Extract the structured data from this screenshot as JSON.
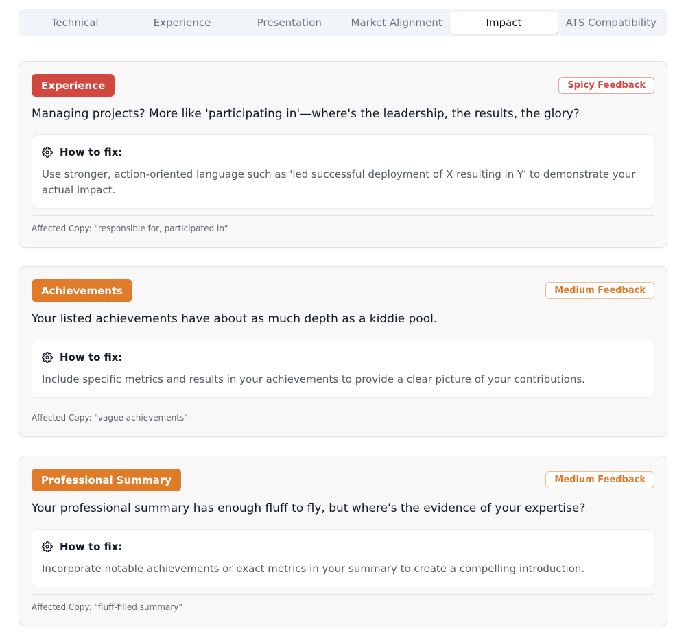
{
  "tabs": [
    "Technical",
    "Experience",
    "Presentation",
    "Market Alignment",
    "Impact",
    "ATS Compatibility"
  ],
  "active_tab": "Impact",
  "fix_label": "How to fix:",
  "colors": {
    "spicy": "#d2473f",
    "medium": "#e07b2a"
  },
  "cards": [
    {
      "category": "Experience",
      "severity": "Spicy Feedback",
      "headline": "Managing projects? More like 'participating in'—where's the leadership, the results, the glory?",
      "fix": "Use stronger, action-oriented language such as 'led successful deployment of X resulting in Y' to demonstrate your actual impact.",
      "affected": "Affected Copy: \"responsible for, participated in\""
    },
    {
      "category": "Achievements",
      "severity": "Medium Feedback",
      "headline": "Your listed achievements have about as much depth as a kiddie pool.",
      "fix": "Include specific metrics and results in your achievements to provide a clear picture of your contributions.",
      "affected": "Affected Copy: \"vague achievements\""
    },
    {
      "category": "Professional Summary",
      "severity": "Medium Feedback",
      "headline": "Your professional summary has enough fluff to fly, but where's the evidence of your expertise?",
      "fix": "Incorporate notable achievements or exact metrics in your summary to create a compelling introduction.",
      "affected": "Affected Copy: \"fluff-filled summary\""
    }
  ]
}
